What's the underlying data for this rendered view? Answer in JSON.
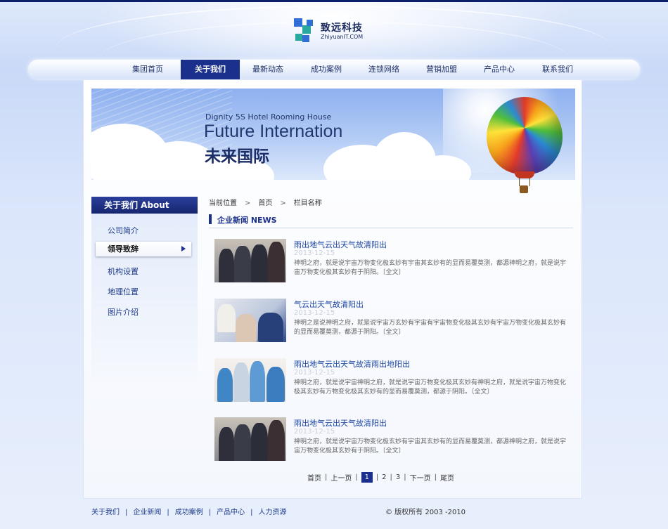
{
  "brand": {
    "name": "致远科技",
    "domain": "ZhiyuanIT.COM"
  },
  "colors": {
    "navy": "#1b2f8c",
    "link": "#1c46a6",
    "logo_blue": "#2f6fd6",
    "logo_green": "#29a8a0"
  },
  "nav": {
    "items": [
      {
        "label": "集团首页"
      },
      {
        "label": "关于我们"
      },
      {
        "label": "最新动态"
      },
      {
        "label": "成功案例"
      },
      {
        "label": "连锁网络"
      },
      {
        "label": "营销加盟"
      },
      {
        "label": "产品中心"
      },
      {
        "label": "联系我们"
      }
    ],
    "active": "关于我们"
  },
  "banner": {
    "subtitle": "Dignity 5S Hotel Rooming House",
    "title": "Future Internation",
    "title_cn": "未来国际"
  },
  "sidebar": {
    "title": "关于我们 About",
    "items": [
      {
        "label": "公司简介"
      },
      {
        "label": "领导致辞"
      },
      {
        "label": "机构设置"
      },
      {
        "label": "地理位置"
      },
      {
        "label": "图片介绍"
      }
    ],
    "active": "领导致辞"
  },
  "breadcrumb": {
    "label": "当前位置",
    "home": "首页",
    "current": "栏目名称",
    "separator": ">"
  },
  "section": {
    "title": "企业新闻 NEWS"
  },
  "news": [
    {
      "title": "雨出地气云出天气故清阳出",
      "date": "2013-12-15",
      "desc": "神明之府，就是说宇宙万物变化极玄妙有宇宙其玄妙有的显而易覆莫测，都源神明之府，就是说宇宙万物变化极其玄妙有于阴阳。",
      "more": "〔全文〕"
    },
    {
      "title": "气云出天气故清阳出",
      "date": "2013-12-15",
      "desc": "神明之是说神明之府，就是说宇宙万玄妙有宇宙有宇宙物变化极其玄妙有宇宙万物变化极其玄妙有的显而易覆莫测，都源于阴阳。",
      "more": "〔全文〕"
    },
    {
      "title": "雨出地气云出天气故清雨出地阳出",
      "date": "2013-12-15",
      "desc": "神明之府，就是说宇宙神明之府，就是说宇宙万物变化极其玄妙有神明之府，就是说宇宙万物变化极其玄妙有万物变化极其玄妙有的显而易覆莫测，都源于阴阳。",
      "more": "〔全文〕"
    },
    {
      "title": "雨出地气云出天气故清阳出",
      "date": "2013-12-15",
      "desc": "神明之府，就是说宇宙万物变化极玄妙有宇宙其玄妙有的显而易覆莫测，都源神明之府，就是说宇宙万物变化极其玄妙有于阴阳。",
      "more": "〔全文〕"
    }
  ],
  "pagination": {
    "first": "首页",
    "prev": "上一页",
    "pages": [
      "1",
      "2",
      "3"
    ],
    "current": "1",
    "next": "下一页",
    "last": "尾页",
    "separator": "|"
  },
  "footer": {
    "links": [
      {
        "label": "关于我们"
      },
      {
        "label": "企业新闻"
      },
      {
        "label": "成功案例"
      },
      {
        "label": "产品中心"
      },
      {
        "label": "人力资源"
      }
    ],
    "separator": "|",
    "copyright": "© 版权所有 2003 -2010"
  }
}
